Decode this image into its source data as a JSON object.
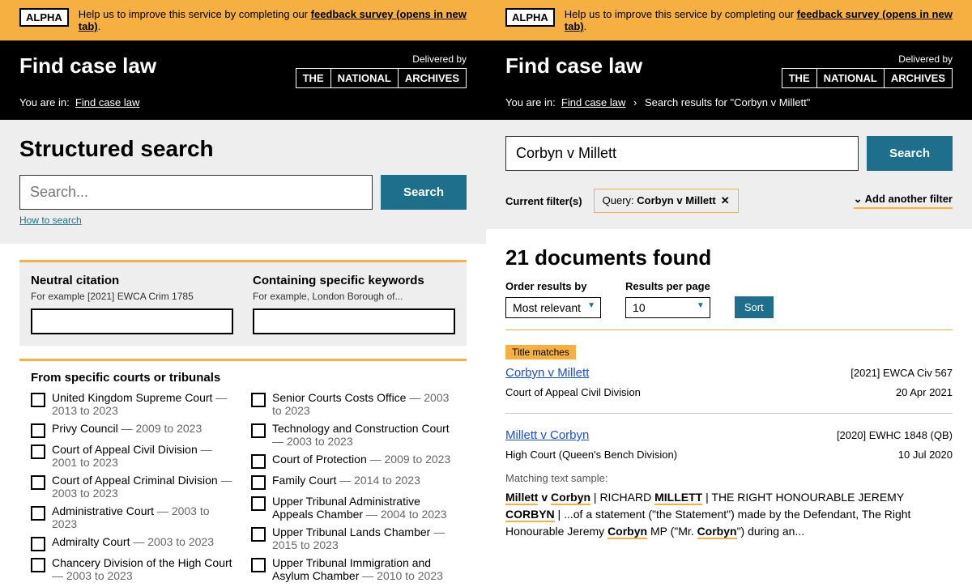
{
  "alpha": {
    "tag": "ALPHA",
    "pre": "Help us to improve this service by completing our ",
    "link": "feedback survey (opens in new tab)",
    "post": "."
  },
  "header": {
    "site_title": "Find case law",
    "delivered": "Delivered by",
    "tna": [
      "THE",
      "NATIONAL",
      "ARCHIVES"
    ],
    "you_are_in": "You are in:",
    "bc_home": "Find case law"
  },
  "left": {
    "heading": "Structured search",
    "search_placeholder": "Search...",
    "search_btn": "Search",
    "how_to": "How to search",
    "nc_label": "Neutral citation",
    "nc_hint": "For example [2021] EWCA Crim 1785",
    "kw_label": "Containing specific keywords",
    "kw_hint": "For example, London Borough of...",
    "courts_label": "From specific courts or tribunals",
    "courts_col1": [
      {
        "name": "United Kingdom Supreme Court",
        "range": "— 2013 to 2023"
      },
      {
        "name": "Privy Council",
        "range": "— 2009 to 2023"
      },
      {
        "name": "Court of Appeal Civil Division",
        "range": "— 2001 to 2023"
      },
      {
        "name": "Court of Appeal Criminal Division",
        "range": "— 2003 to 2023"
      },
      {
        "name": "Administrative Court",
        "range": "— 2003 to 2023"
      },
      {
        "name": "Admiralty Court",
        "range": "— 2003 to 2023"
      },
      {
        "name": "Chancery Division of the High Court",
        "range": "— 2003 to 2023"
      }
    ],
    "courts_col2": [
      {
        "name": "Senior Courts Costs Office",
        "range": "— 2003 to 2023"
      },
      {
        "name": "Technology and Construction Court",
        "range": "— 2003 to 2023"
      },
      {
        "name": "Court of Protection",
        "range": "— 2009 to 2023"
      },
      {
        "name": "Family Court",
        "range": "— 2014 to 2023"
      },
      {
        "name": "Upper Tribunal Administrative Appeals Chamber",
        "range": "— 2004 to 2023"
      },
      {
        "name": "Upper Tribunal Lands Chamber",
        "range": "— 2015 to 2023"
      },
      {
        "name": "Upper Tribunal Immigration and Asylum Chamber",
        "range": "— 2010 to 2023"
      }
    ]
  },
  "right": {
    "bc_results": "Search results for \"Corbyn v Millett\"",
    "search_value": "Corbyn v Millett",
    "search_btn": "Search",
    "current_filters": "Current filter(s)",
    "chip_label": "Query: ",
    "chip_value": "Corbyn v Millett",
    "add_filter": "Add another filter",
    "results_heading": "21 documents found",
    "order_label": "Order results by",
    "order_value": "Most relevant",
    "rpp_label": "Results per page",
    "rpp_value": "10",
    "sort_btn": "Sort",
    "title_matches": "Title matches",
    "r1_title": "Corbyn v Millett",
    "r1_cite": "[2021] EWCA Civ 567",
    "r1_court": "Court of Appeal Civil Division",
    "r1_date": "20 Apr 2021",
    "r2_title": "Millett v Corbyn",
    "r2_cite": "[2020] EWHC 1848 (QB)",
    "r2_court": "High Court (Queen's Bench Division)",
    "r2_date": "10 Jul 2020",
    "snippet_label": "Matching text sample:"
  }
}
